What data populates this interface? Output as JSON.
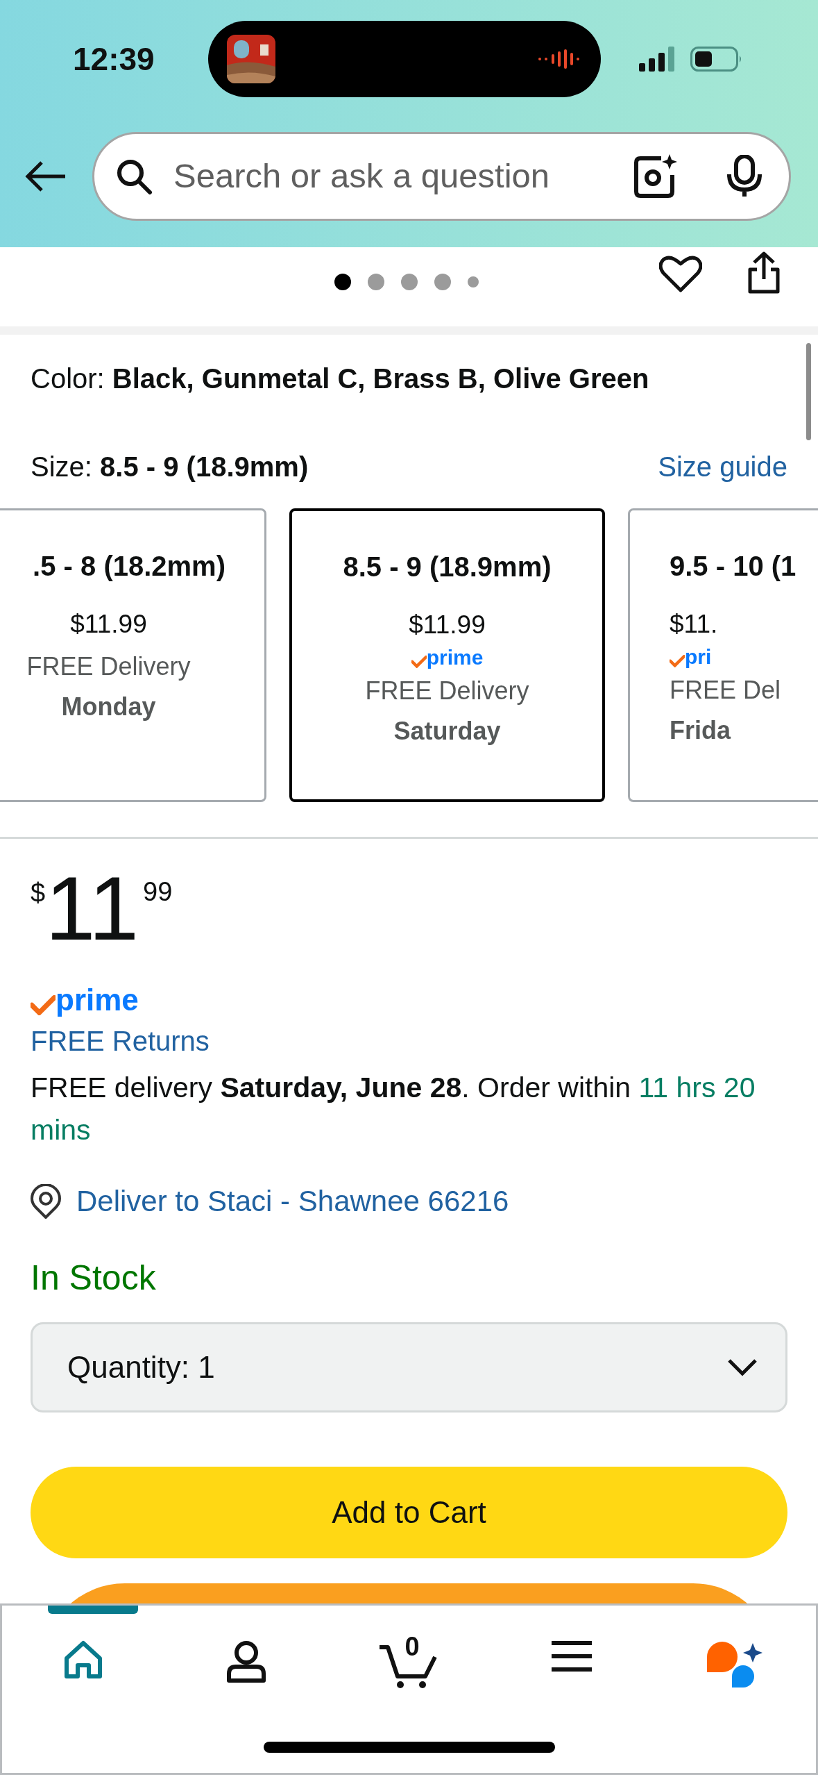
{
  "status_bar": {
    "time": "12:39"
  },
  "search": {
    "placeholder": "Search or ask a question"
  },
  "carousel": {
    "dots": [
      {
        "selected": true
      },
      {
        "selected": false
      },
      {
        "selected": false
      },
      {
        "selected": false
      },
      {
        "selected": false
      }
    ]
  },
  "color": {
    "label": "Color:",
    "value": "Black, Gunmetal C, Brass B, Olive Green"
  },
  "size": {
    "label": "Size:",
    "value": "8.5 - 9 (18.9mm)",
    "guide_link": "Size guide"
  },
  "size_options": [
    {
      "title": ".5 - 8 (18.2mm)",
      "price": "$11.99",
      "delivery": "FREE Delivery",
      "day": "Monday",
      "selected": false
    },
    {
      "title": "8.5 - 9 (18.9mm)",
      "price": "$11.99",
      "badge": "prime",
      "delivery": "FREE Delivery",
      "day": "Saturday",
      "selected": true
    },
    {
      "title": "9.5 - 10 (1",
      "price": "$11.",
      "badge": "pri",
      "delivery": "FREE Del",
      "day": "Frida",
      "selected": false
    }
  ],
  "price": {
    "currency": "$",
    "whole": "11",
    "fraction": "99"
  },
  "prime_badge": "prime",
  "returns_link": "FREE Returns",
  "delivery_message": "FREE delivery **Saturday, June 28**. Order within",
  "countdown": "11 hrs 20 mins",
  "deliver_to": "Deliver to Staci - Shawnee 66216",
  "stock": "In Stock",
  "quantity": {
    "label": "Quantity:",
    "value": "1"
  },
  "add_to_cart": "Add to Cart",
  "nav": [
    {
      "kind": "home",
      "selected": true
    },
    {
      "kind": "account",
      "selected": false
    },
    {
      "kind": "cart",
      "selected": false,
      "count": "0"
    },
    {
      "kind": "menu",
      "selected": false
    },
    {
      "kind": "assistant",
      "selected": false
    }
  ]
}
